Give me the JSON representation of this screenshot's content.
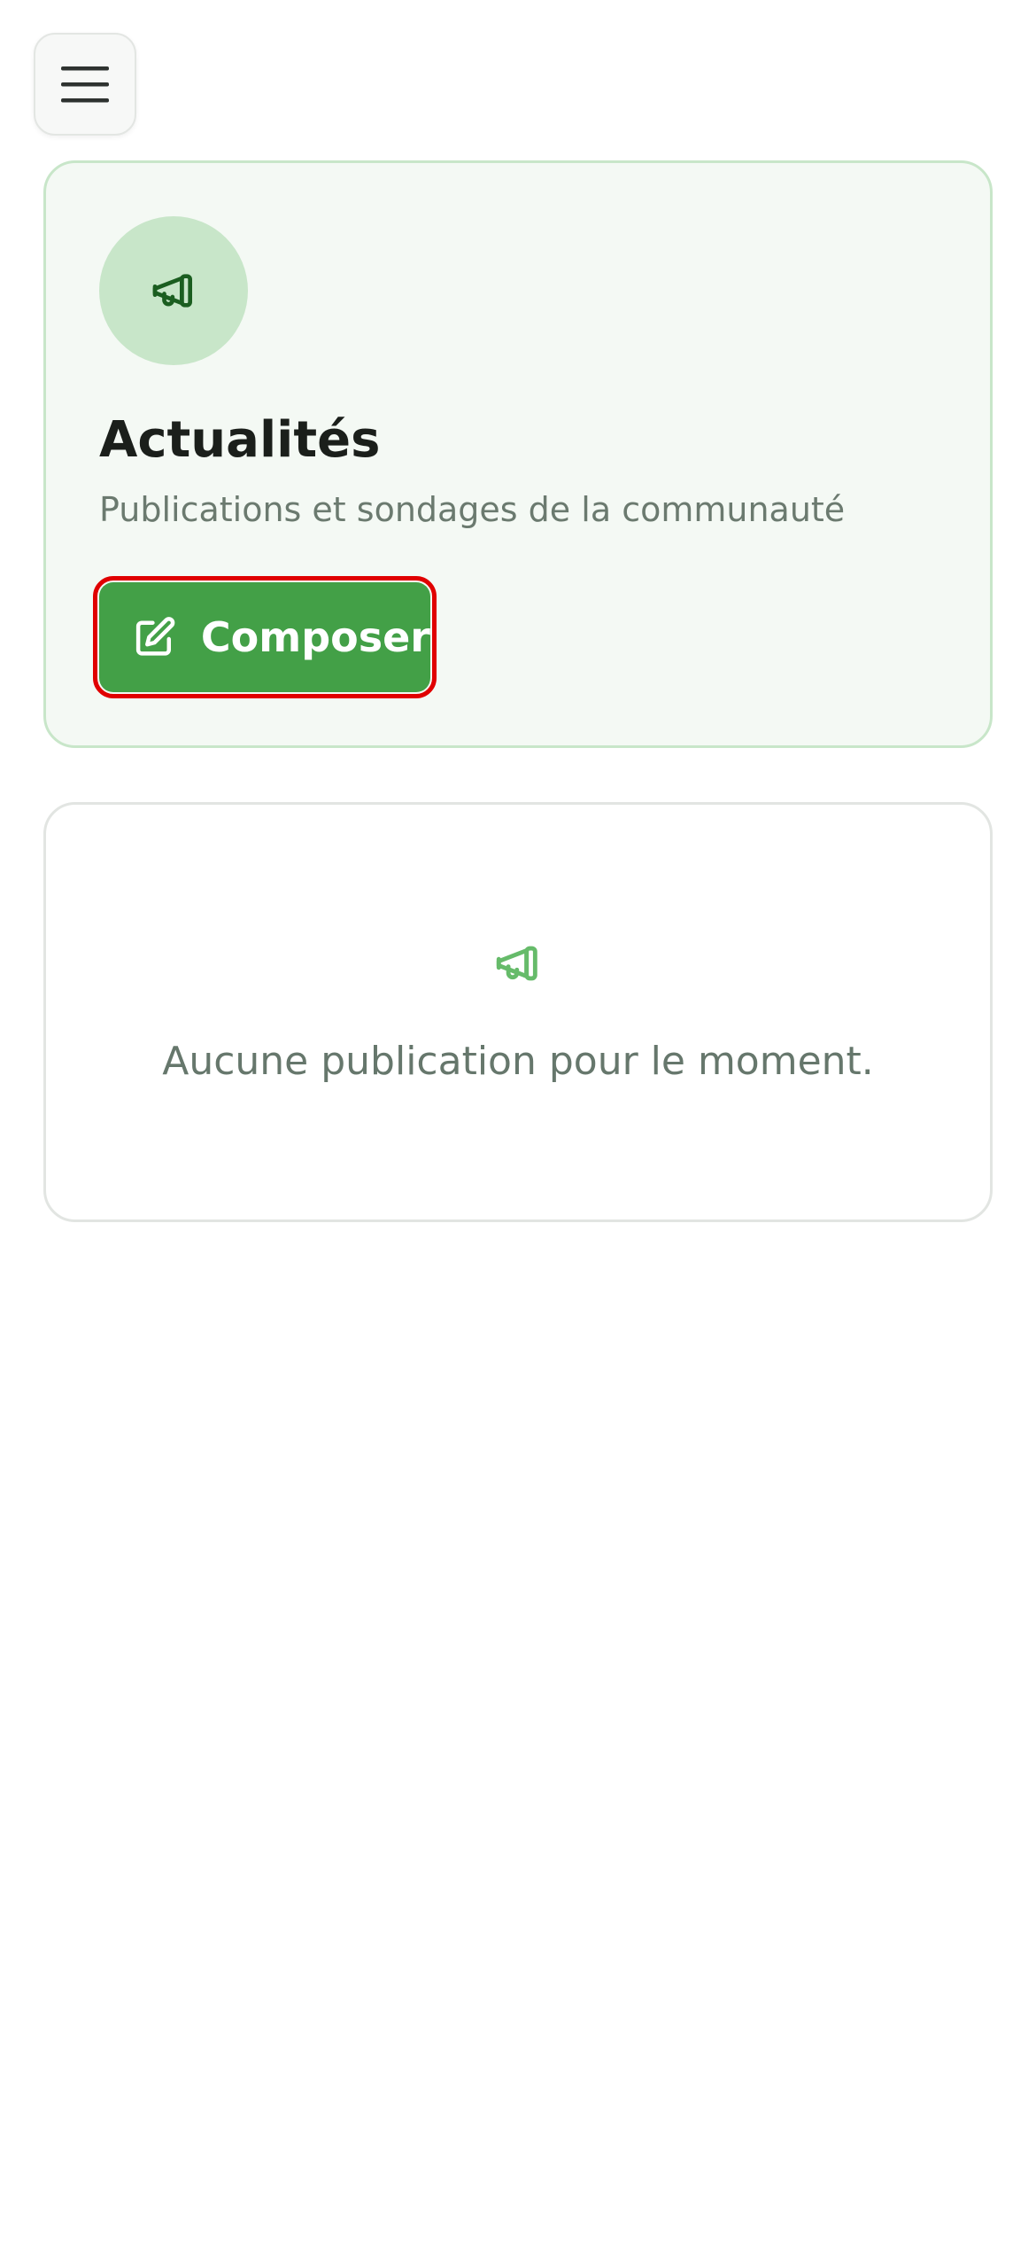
{
  "nav": {
    "menu_icon": "hamburger-menu-icon"
  },
  "hero": {
    "icon": "megaphone-icon",
    "title": "Actualités",
    "subtitle": "Publications et sondages de la communauté",
    "compose_icon": "edit-square-icon",
    "compose_label": "Composer"
  },
  "empty_state": {
    "icon": "megaphone-icon",
    "message": "Aucune publication pour le moment."
  },
  "colors": {
    "accent": "#43a047",
    "accent_light": "#c8e6c9",
    "card_background": "#f4f9f4",
    "icon_dark": "#1b5e20",
    "icon_light": "#66bb6a",
    "highlight_outline": "#e00000"
  }
}
